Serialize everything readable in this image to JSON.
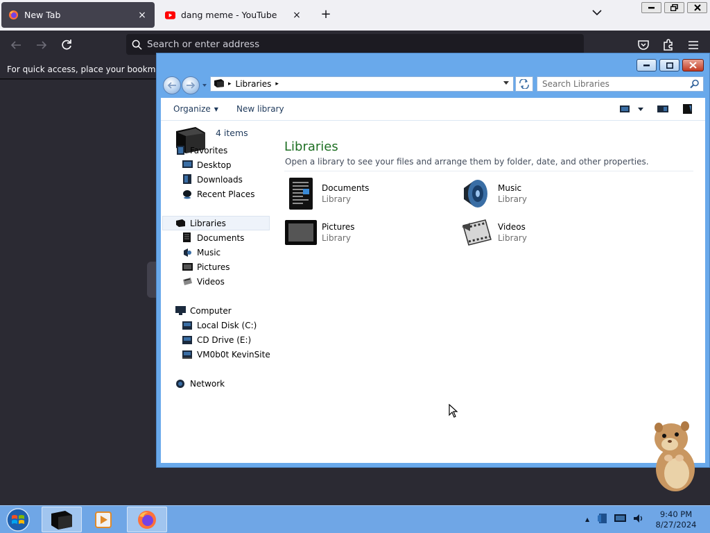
{
  "firefox": {
    "tabs": [
      {
        "label": "New Tab",
        "close": "×"
      },
      {
        "label": "dang meme - YouTube",
        "close": "×"
      }
    ],
    "new_tab": "+",
    "window_controls": {
      "minimize": "–",
      "restore": "❐",
      "close": "✕"
    },
    "url_placeholder": "Search or enter address",
    "bookmarks_bar_text": "For quick access, place your bookmarks here on the bookmarks toolbar.",
    "colors": {
      "tabbar": "#f0f0f4",
      "active_tab": "#42414d",
      "toolbar": "#2b2a33",
      "youtube_red": "#ff0000"
    }
  },
  "explorer": {
    "breadcrumb": [
      "Libraries"
    ],
    "search_placeholder": "Search Libraries",
    "toolbar": {
      "organize": "Organize",
      "new_library": "New library"
    },
    "items_count": "4 items",
    "nav": {
      "favorites": {
        "label": "Favorites",
        "children": [
          "Desktop",
          "Downloads",
          "Recent Places"
        ]
      },
      "libraries": {
        "label": "Libraries",
        "children": [
          "Documents",
          "Music",
          "Pictures",
          "Videos"
        ]
      },
      "computer": {
        "label": "Computer",
        "children": [
          "Local Disk (C:)",
          "CD Drive (E:)",
          "VM0b0t KevinSite"
        ]
      },
      "network": {
        "label": "Network"
      }
    },
    "content": {
      "title": "Libraries",
      "description": "Open a library to see your files and arrange them by folder, date, and other properties.",
      "libraries": [
        {
          "name": "Documents",
          "type": "Library",
          "icon": "documents-library-icon"
        },
        {
          "name": "Music",
          "type": "Library",
          "icon": "music-library-icon"
        },
        {
          "name": "Pictures",
          "type": "Library",
          "icon": "pictures-library-icon"
        },
        {
          "name": "Videos",
          "type": "Library",
          "icon": "videos-library-icon"
        }
      ]
    },
    "colors": {
      "frame": "#69a9eb",
      "title_green": "#1e6f23",
      "link_blue": "#1e395b"
    }
  },
  "taskbar": {
    "clock": {
      "time": "9:40 PM",
      "date": "8/27/2024"
    },
    "tray_arrow": "▲",
    "color": "#6fa6e6"
  }
}
